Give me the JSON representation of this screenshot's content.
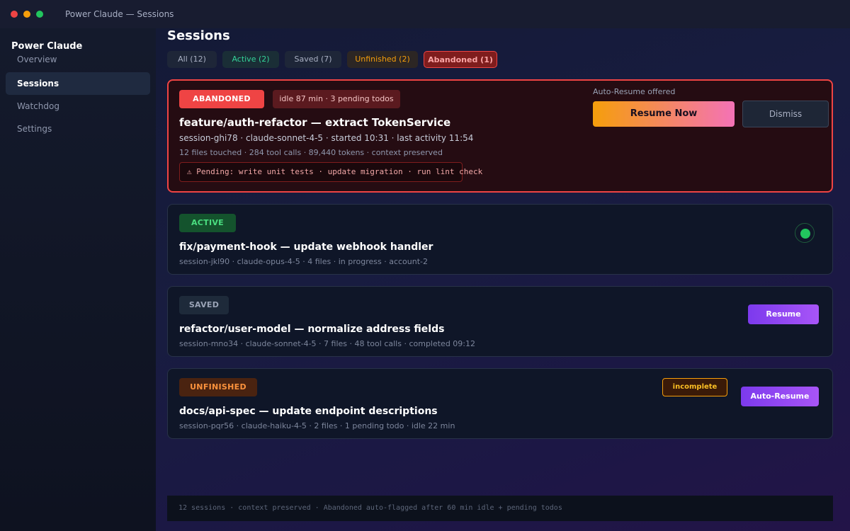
{
  "window": {
    "title": "Power Claude — Sessions"
  },
  "sidebar": {
    "brand": "Power Claude",
    "items": [
      {
        "label": "Overview"
      },
      {
        "label": "Sessions"
      },
      {
        "label": "Watchdog"
      },
      {
        "label": "Settings"
      }
    ],
    "active_index": 1
  },
  "main": {
    "title": "Sessions",
    "tabs": [
      {
        "label": "All (12)"
      },
      {
        "label": "Active (2)"
      },
      {
        "label": "Saved (7)"
      },
      {
        "label": "Unfinished (2)"
      },
      {
        "label": "Abandoned (1)"
      }
    ],
    "selected_tab": "Abandoned (1)",
    "cards": {
      "abandoned": {
        "badge": "ABANDONED",
        "idle_chip": "idle 87 min · 3 pending todos",
        "title": "feature/auth-refactor — extract TokenService",
        "meta_primary": "session-ghi78 · claude-sonnet-4-5 · started 10:31 · last activity 11:54",
        "meta_secondary": "12 files touched · 284 tool calls · 89,440 tokens · context preserved",
        "pending_icon": "warning-icon",
        "pending": "⚠ Pending: write unit tests · update migration · run lint check",
        "offer_label": "Auto-Resume offered",
        "resume_now": "Resume Now",
        "dismiss": "Dismiss"
      },
      "active": {
        "badge": "ACTIVE",
        "title": "fix/payment-hook — update webhook handler",
        "meta": "session-jkl90 · claude-opus-4-5 · 4 files · in progress · account-2",
        "status_icon": "running-dot-icon",
        "status_color": "#22c55e"
      },
      "saved": {
        "badge": "SAVED",
        "title": "refactor/user-model — normalize address fields",
        "meta": "session-mno34 · claude-sonnet-4-5 · 7 files · 48 tool calls · completed 09:12",
        "resume": "Resume"
      },
      "unfinished": {
        "badge": "UNFINISHED",
        "tag": "incomplete",
        "title": "docs/api-spec — update endpoint descriptions",
        "meta": "session-pqr56 · claude-haiku-4-5 · 2 files · 1 pending todo · idle 22 min",
        "auto_resume": "Auto-Resume"
      }
    },
    "footer": "12 sessions · context preserved · Abandoned auto-flagged after 60 min idle + pending todos"
  },
  "colors": {
    "danger": "#ef4444",
    "success": "#22c55e",
    "warning": "#f59e0b",
    "purple": "#7c3aed",
    "resume_gradient_start": "#f59e0b",
    "resume_gradient_end": "#f472b6"
  }
}
